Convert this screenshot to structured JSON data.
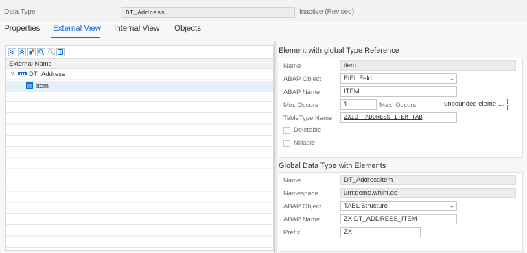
{
  "header": {
    "label": "Data Type",
    "value": "DT_Address",
    "status": "Inactive (Revised)"
  },
  "tabs": [
    {
      "label": "Properties"
    },
    {
      "label": "External View"
    },
    {
      "label": "Internal View"
    },
    {
      "label": "Objects"
    }
  ],
  "tree": {
    "toolbar_icons": [
      "expand-all-icon",
      "collapse-all-icon",
      "insert-icon",
      "search-icon",
      "search-next-icon",
      "table-settings-icon"
    ],
    "column_header": "External Name",
    "nodes": [
      {
        "label": "DT_Address",
        "icon": "complex-type-icon",
        "expanded": true
      },
      {
        "label": "item",
        "icon": "element-icon",
        "selected": true
      }
    ]
  },
  "element_section": {
    "title": "Element with global Type Reference",
    "name_label": "Name",
    "name_value": "item",
    "abap_object_label": "ABAP Object",
    "abap_object_value": "FIEL Feld",
    "abap_name_label": "ABAP Name",
    "abap_name_value": "ITEM",
    "min_occurs_label": "Min. Occurs",
    "min_occurs_value": "1",
    "max_occurs_label": "Max. Occurs",
    "max_occurs_value": "unbounded eleme...",
    "tabletype_label": "TableType Name",
    "tabletype_value": "ZXIDT_ADDRESS_ITEM_TAB",
    "deletable_label": "Deletable",
    "nillable_label": "Nillable"
  },
  "global_section": {
    "title": "Global Data Type with Elements",
    "name_label": "Name",
    "name_value": "DT_AddressItem",
    "namespace_label": "Namespace",
    "namespace_value": "urn:demo.whint.de",
    "abap_object_label": "ABAP Object",
    "abap_object_value": "TABL Structure",
    "abap_name_label": "ABAP Name",
    "abap_name_value": "ZXIDT_ADDRESS_ITEM",
    "prefix_label": "Prefix",
    "prefix_value": "ZXI"
  },
  "colors": {
    "accent": "#0a6ed1",
    "selection": "#e5f0fa"
  }
}
